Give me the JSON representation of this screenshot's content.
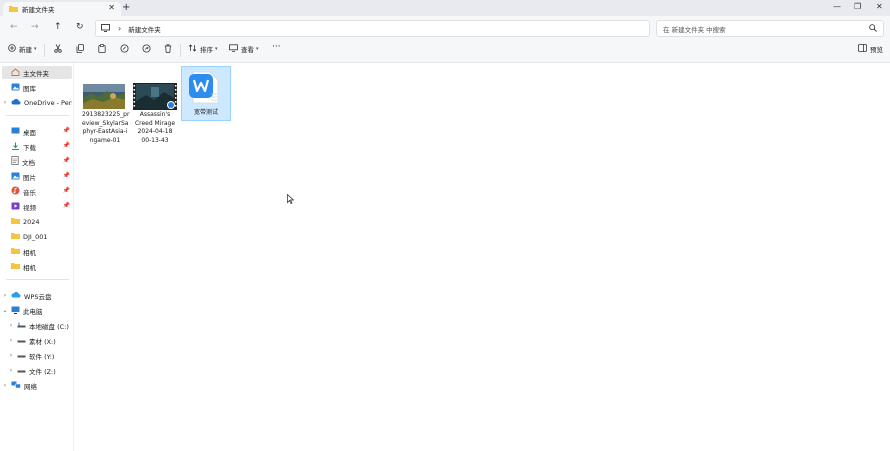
{
  "window": {
    "tab_title": "新建文件夹",
    "close_tab": "✕",
    "new_tab": "+",
    "minimize": "—",
    "maximize": "❐",
    "close": "✕"
  },
  "addressbar": {
    "breadcrumb": "新建文件夹",
    "search_placeholder": "在 新建文件夹 中搜索"
  },
  "toolbar": {
    "new_label": "新建",
    "sort_label": "排序",
    "view_label": "查看",
    "more_label": "···",
    "preview_label": "预览"
  },
  "sidebar": {
    "home": "主文件夹",
    "gallery": "图库",
    "onedrive": "OneDrive - Perso",
    "quick": [
      "桌面",
      "下载",
      "文档",
      "图片",
      "音乐",
      "视频",
      "2024",
      "DJI_001",
      "相机",
      "相机"
    ],
    "wps": "WPS云盘",
    "thispc": "此电脑",
    "drives": [
      "本地磁盘 (C:)",
      "素材 (X:)",
      "软件 (Y:)",
      "文件 (Z:)"
    ],
    "network": "网络"
  },
  "files": [
    {
      "lines": [
        "2913823225_pr",
        "eview_SkylarSa",
        "phyr-EastAsia-i",
        "ngame-01"
      ],
      "type": "image"
    },
    {
      "lines": [
        "Assassin's",
        "Creed Mirage",
        "2024-04-18",
        "00-13-43"
      ],
      "type": "video"
    },
    {
      "lines": [
        "宽带测试"
      ],
      "type": "wps-document"
    }
  ],
  "colors": {
    "accent": "#0067c0",
    "selection_bg": "#cde8ff",
    "selection_border": "#99d1ff",
    "folder_yellow": "#f6c342",
    "wps_blue": "#2d8cf0"
  }
}
